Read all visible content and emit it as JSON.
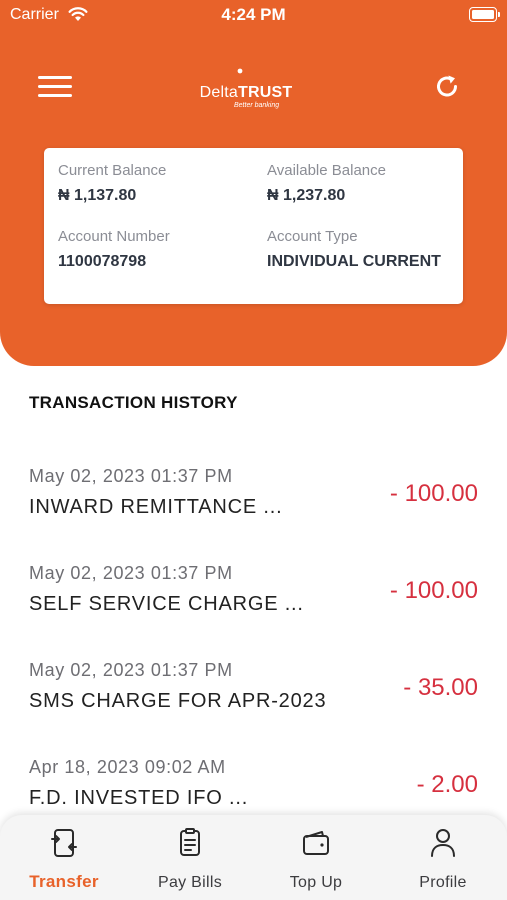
{
  "status_bar": {
    "carrier": "Carrier",
    "time": "4:24 PM"
  },
  "brand": {
    "name_regular": "Delta",
    "name_bold": "TRUST",
    "tagline": "Better banking"
  },
  "account": {
    "current_balance_label": "Current Balance",
    "current_balance": "₦ 1,137.80",
    "available_balance_label": "Available Balance",
    "available_balance": "₦ 1,237.80",
    "account_number_label": "Account Number",
    "account_number": "1100078798",
    "account_type_label": "Account Type",
    "account_type": "INDIVIDUAL CURRENT"
  },
  "history": {
    "title": "TRANSACTION HISTORY",
    "items": [
      {
        "date": "May 02, 2023 01:37 PM",
        "description": "INWARD REMITTANCE ...",
        "amount": "- 100.00"
      },
      {
        "date": "May 02, 2023 01:37 PM",
        "description": "SELF SERVICE CHARGE ...",
        "amount": "- 100.00"
      },
      {
        "date": "May 02, 2023 01:37 PM",
        "description": "SMS CHARGE FOR APR-2023",
        "amount": "- 35.00"
      },
      {
        "date": "Apr 18, 2023 09:02 AM",
        "description": "F.D. INVESTED IFO ...",
        "amount": "- 2.00"
      }
    ]
  },
  "tabs": [
    {
      "label": "Transfer",
      "icon": "transfer-icon",
      "active": true
    },
    {
      "label": "Pay Bills",
      "icon": "bill-icon",
      "active": false
    },
    {
      "label": "Top Up",
      "icon": "wallet-icon",
      "active": false
    },
    {
      "label": "Profile",
      "icon": "person-icon",
      "active": false
    }
  ],
  "colors": {
    "brand_orange": "#e8622a",
    "debit_red": "#d6303f",
    "card_bg": "#ffffff",
    "tabbar_bg": "#f5f5f5"
  }
}
